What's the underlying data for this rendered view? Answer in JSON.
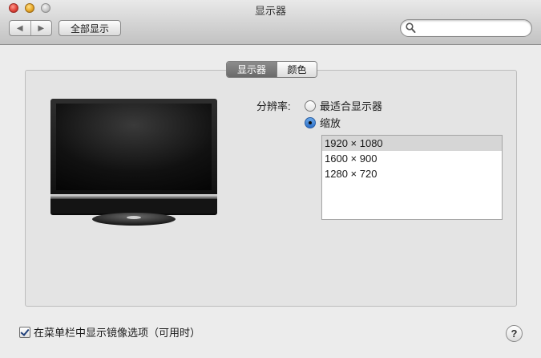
{
  "window": {
    "title": "显示器"
  },
  "toolbar": {
    "back_icon": "back-arrow-icon",
    "forward_icon": "forward-arrow-icon",
    "show_all_label": "全部显示",
    "search": {
      "placeholder": "",
      "value": ""
    }
  },
  "tabs": [
    {
      "label": "显示器",
      "selected": true
    },
    {
      "label": "颜色",
      "selected": false
    }
  ],
  "resolution": {
    "label": "分辨率:",
    "options": [
      {
        "label": "最适合显示器",
        "selected": false
      },
      {
        "label": "缩放",
        "selected": true
      }
    ],
    "list": [
      {
        "value": "1920 × 1080",
        "selected": true
      },
      {
        "value": "1600 × 900",
        "selected": false
      },
      {
        "value": "1280 × 720",
        "selected": false
      }
    ]
  },
  "footer": {
    "mirror_label": "在菜单栏中显示镜像选项（可用时）",
    "mirror_checked": true,
    "help_label": "?"
  },
  "colors": {
    "accent": "#2c6fc9",
    "selected_tab": "#7a7a7a",
    "list_selection": "#d6d6d6"
  }
}
